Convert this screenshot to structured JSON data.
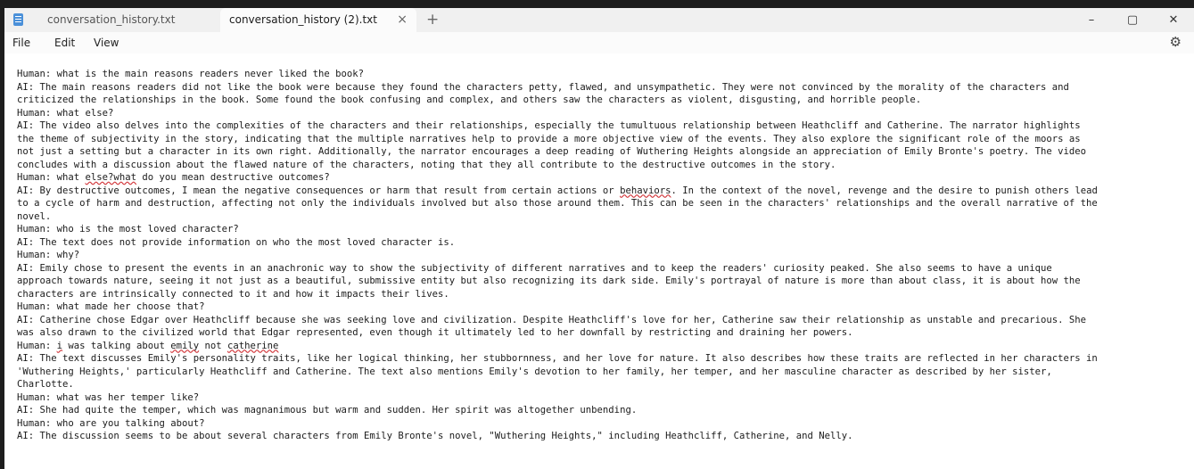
{
  "tabs": [
    {
      "label": "conversation_history.txt"
    },
    {
      "label": "conversation_history (2).txt",
      "close": "×"
    }
  ],
  "new_tab": "+",
  "window_controls": {
    "minimize": "–",
    "maximize": "▢",
    "close": "✕"
  },
  "menu": {
    "file": "File",
    "edit": "Edit",
    "view": "View",
    "settings_icon": "⚙"
  },
  "colors": {
    "spellcheck_underline": "#d13438",
    "tab_active": "#fbfbfb",
    "tabbar": "#f0f0f0"
  },
  "editor_lines": [
    "Human: what is the main reasons readers never liked the book?",
    "AI: The main reasons readers did not like the book were because they found the characters petty, flawed, and unsympathetic. They were not convinced by the morality of the characters and",
    "criticized the relationships in the book. Some found the book confusing and complex, and others saw the characters as violent, disgusting, and horrible people.",
    "Human: what else?",
    "AI: The video also delves into the complexities of the characters and their relationships, especially the tumultuous relationship between Heathcliff and Catherine. The narrator highlights",
    "the theme of subjectivity in the story, indicating that the multiple narratives help to provide a more objective view of the events. They also explore the significant role of the moors as",
    "not just a setting but a character in its own right. Additionally, the narrator encourages a deep reading of Wuthering Heights alongside an appreciation of Emily Bronte's poetry. The video",
    "concludes with a discussion about the flawed nature of the characters, noting that they all contribute to the destructive outcomes in the story.",
    "Human: what else?what do you mean destructive outcomes?",
    "AI: By destructive outcomes, I mean the negative consequences or harm that result from certain actions or behaviors. In the context of the novel, revenge and the desire to punish others lead",
    "to a cycle of harm and destruction, affecting not only the individuals involved but also those around them. This can be seen in the characters' relationships and the overall narrative of the",
    "novel.",
    "Human: who is the most loved character?",
    "AI: The text does not provide information on who the most loved character is.",
    "Human: why?",
    "AI: Emily chose to present the events in an anachronic way to show the subjectivity of different narratives and to keep the readers' curiosity peaked. She also seems to have a unique",
    "approach towards nature, seeing it not just as a beautiful, submissive entity but also recognizing its dark side. Emily's portrayal of nature is more than about class, it is about how the",
    "characters are intrinsically connected to it and how it impacts their lives.",
    "Human: what made her choose that?",
    "AI: Catherine chose Edgar over Heathcliff because she was seeking love and civilization. Despite Heathcliff's love for her, Catherine saw their relationship as unstable and precarious. She",
    "was also drawn to the civilized world that Edgar represented, even though it ultimately led to her downfall by restricting and draining her powers.",
    "Human: i was talking about emily not catherine",
    "AI: The text discusses Emily's personality traits, like her logical thinking, her stubbornness, and her love for nature. It also describes how these traits are reflected in her characters in",
    "'Wuthering Heights,' particularly Heathcliff and Catherine. The text also mentions Emily's devotion to her family, her temper, and her masculine character as described by her sister,",
    "Charlotte.",
    "Human: what was her temper like?",
    "AI: She had quite the temper, which was magnanimous but warm and sudden. Her spirit was altogether unbending.",
    "Human: who are you talking about?",
    "AI: The discussion seems to be about several characters from Emily Bronte's novel, \"Wuthering Heights,\" including Heathcliff, Catherine, and Nelly."
  ],
  "spellcheck_words": [
    {
      "line": 8,
      "word": "else?what"
    },
    {
      "line": 9,
      "word": "behaviors"
    },
    {
      "line": 21,
      "word": "i"
    },
    {
      "line": 21,
      "word": "emily"
    },
    {
      "line": 21,
      "word": "catherine"
    }
  ]
}
